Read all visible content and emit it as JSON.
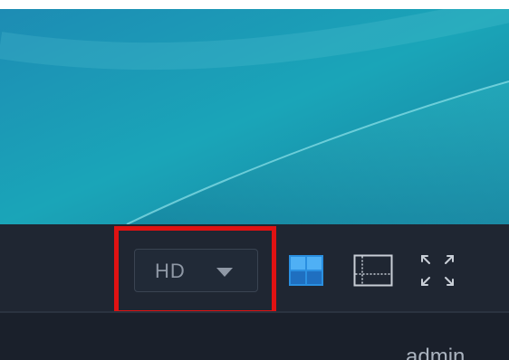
{
  "player": {
    "quality_value": "HD"
  },
  "icons": {
    "caret": "chevron-down-icon",
    "layout_quad": "grid-2x2-icon",
    "layout_single": "single-view-icon",
    "fullscreen": "expand-icon"
  },
  "footer": {
    "user": "admin"
  },
  "colors": {
    "toolbar_bg": "#1f2632",
    "highlight": "#e01212",
    "accent_blue": "#2a8fe0",
    "video_teal": "#1aa2b5"
  }
}
